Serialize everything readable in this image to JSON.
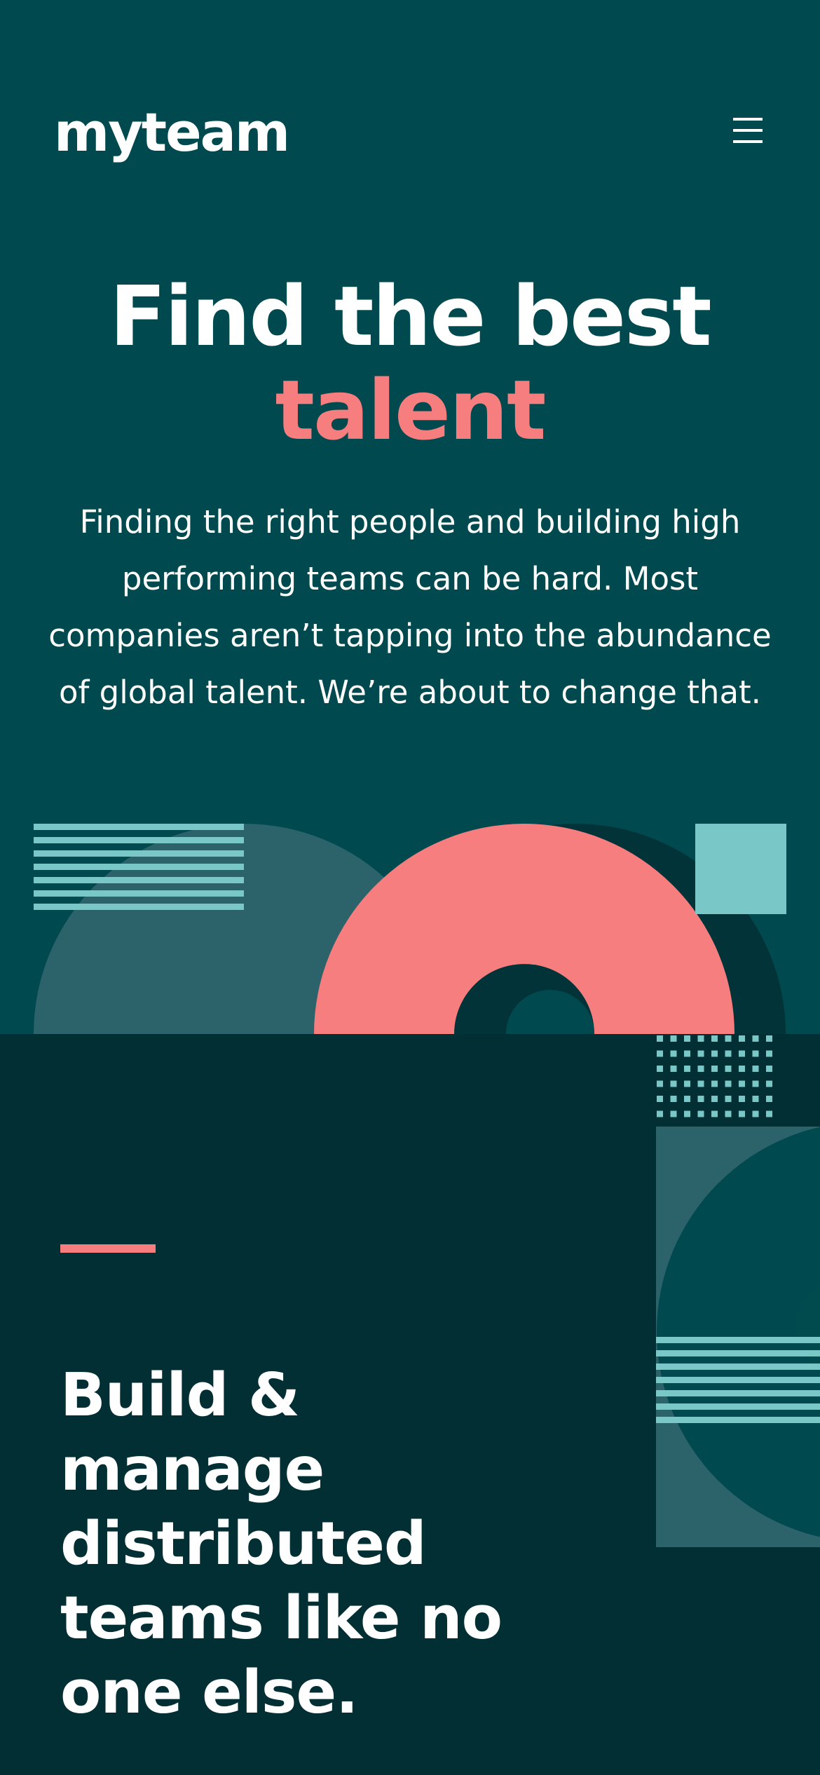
{
  "header": {
    "logo": "myteam",
    "menu_icon": "hamburger-menu-icon"
  },
  "hero": {
    "title": "Find the best",
    "title_accent": "talent",
    "text": "Finding the right people and building high performing teams can be hard. Most companies aren’t tapping into the abundance of global talent. We’re about to change that."
  },
  "feature": {
    "title": "Build & manage distributed teams like no one else."
  },
  "colors": {
    "background": "#004a4f",
    "dark_section": "#012f34",
    "coral": "#f67e7e",
    "aqua": "#79c8c7",
    "white": "#ffffff"
  }
}
